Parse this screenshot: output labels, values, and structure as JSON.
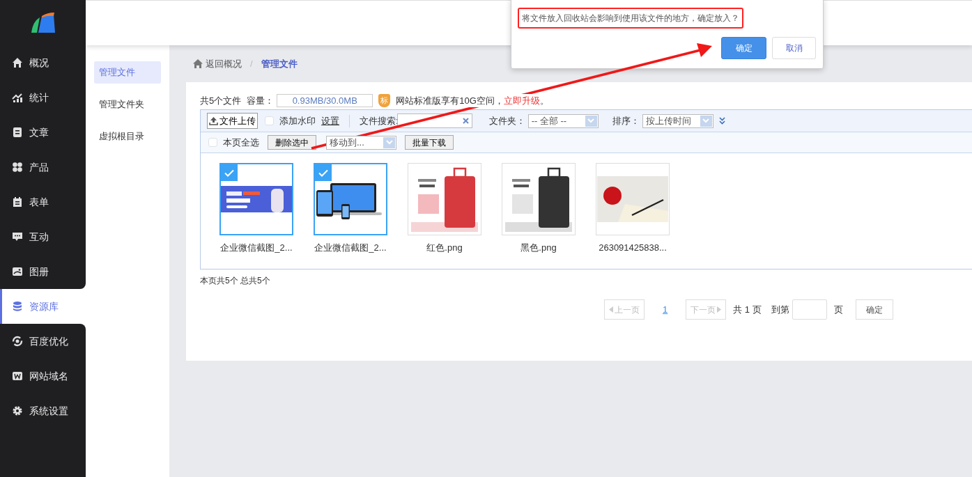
{
  "sidebar": {
    "items": [
      {
        "label": "概况",
        "selected": false
      },
      {
        "label": "统计",
        "selected": false
      },
      {
        "label": "文章",
        "selected": false
      },
      {
        "label": "产品",
        "selected": false
      },
      {
        "label": "表单",
        "selected": false
      },
      {
        "label": "互动",
        "selected": false
      },
      {
        "label": "图册",
        "selected": false
      },
      {
        "label": "资源库",
        "selected": true
      },
      {
        "label": "百度优化",
        "selected": false
      },
      {
        "label": "网站域名",
        "selected": false
      },
      {
        "label": "系统设置",
        "selected": false
      }
    ]
  },
  "subnav": {
    "items": [
      {
        "label": "管理文件",
        "selected": true
      },
      {
        "label": "管理文件夹",
        "selected": false
      },
      {
        "label": "虚拟根目录",
        "selected": false
      }
    ]
  },
  "breadcrumb": {
    "back": "返回概况",
    "separator": "/",
    "current": "管理文件"
  },
  "summary": {
    "count": "共5个文件",
    "capacity_label": "容量：",
    "capacity": "0.93MB/30.0MB",
    "badge": "标",
    "promo": "网站标准版享有10G空间，",
    "promo_link": "立即升级",
    "period": "。"
  },
  "toolbar": {
    "upload": "文件上传",
    "watermark": {
      "label": "添加水印",
      "checked": false
    },
    "settings": "设置",
    "search_label": "文件搜索:",
    "folder_label": "文件夹：",
    "folder_value": "-- 全部 --",
    "sort_label": "排序：",
    "sort_value": "按上传时间"
  },
  "actions": {
    "select_all": {
      "label": "本页全选",
      "checked": false
    },
    "delete": "删除选中",
    "move": "移动到...",
    "download": "批量下载"
  },
  "files": [
    {
      "name": "企业微信截图_2...",
      "selected": true,
      "kind": "banner"
    },
    {
      "name": "企业微信截图_2...",
      "selected": true,
      "kind": "devices"
    },
    {
      "name": "红色.png",
      "selected": false,
      "kind": "suitcase"
    },
    {
      "name": "黑色.png",
      "selected": false,
      "kind": "suitcase-dark"
    },
    {
      "name": "263091425838...",
      "selected": false,
      "kind": "photo"
    }
  ],
  "page_summary": "本页共5个 总共5个",
  "pagination": {
    "prev": "上一页",
    "page": "1",
    "next": "下一页",
    "total": "共 1 页",
    "goto": "到第",
    "unit": "页",
    "confirm": "确定"
  },
  "dialog": {
    "message": "将文件放入回收站会影响到使用该文件的地方，确定放入？",
    "ok": "确定",
    "cancel": "取消"
  }
}
